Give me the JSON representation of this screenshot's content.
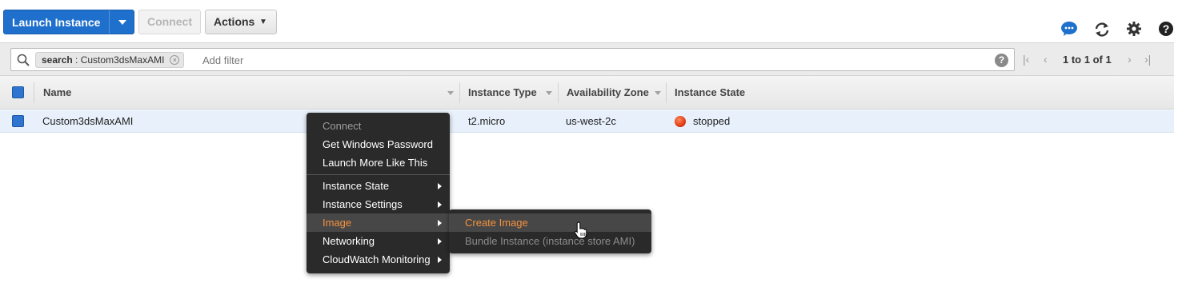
{
  "toolbar": {
    "launch_label": "Launch Instance",
    "connect_label": "Connect",
    "actions_label": "Actions",
    "icons": [
      "chat-icon",
      "refresh-icon",
      "gear-icon",
      "help-icon"
    ]
  },
  "filter": {
    "token_key": "search",
    "token_sep": " : ",
    "token_value": "Custom3dsMaxAMI",
    "placeholder": "Add filter",
    "pagination": "1 to 1 of 1"
  },
  "table": {
    "columns": [
      "Name",
      "Instance Type",
      "Availability Zone",
      "Instance State"
    ],
    "rows": [
      {
        "name": "Custom3dsMaxAMI",
        "instance_type": "t2.micro",
        "availability_zone": "us-west-2c",
        "instance_state": "stopped",
        "selected": true
      }
    ]
  },
  "context_menu": {
    "items": [
      {
        "label": "Connect",
        "disabled": true
      },
      {
        "label": "Get Windows Password"
      },
      {
        "label": "Launch More Like This"
      },
      {
        "label": "Instance State",
        "submenu": true
      },
      {
        "label": "Instance Settings",
        "submenu": true
      },
      {
        "label": "Image",
        "submenu": true,
        "active": true
      },
      {
        "label": "Networking",
        "submenu": true
      },
      {
        "label": "CloudWatch Monitoring",
        "submenu": true
      }
    ],
    "image_submenu": [
      {
        "label": "Create Image",
        "active": true
      },
      {
        "label": "Bundle Instance (instance store AMI)",
        "disabled": true
      }
    ]
  },
  "colors": {
    "primary": "#1f6fcc",
    "menu_bg": "#2a2a2a",
    "menu_highlight": "#f5923e",
    "row_selected": "#e7f0fb",
    "stopped": "#e23a12"
  }
}
